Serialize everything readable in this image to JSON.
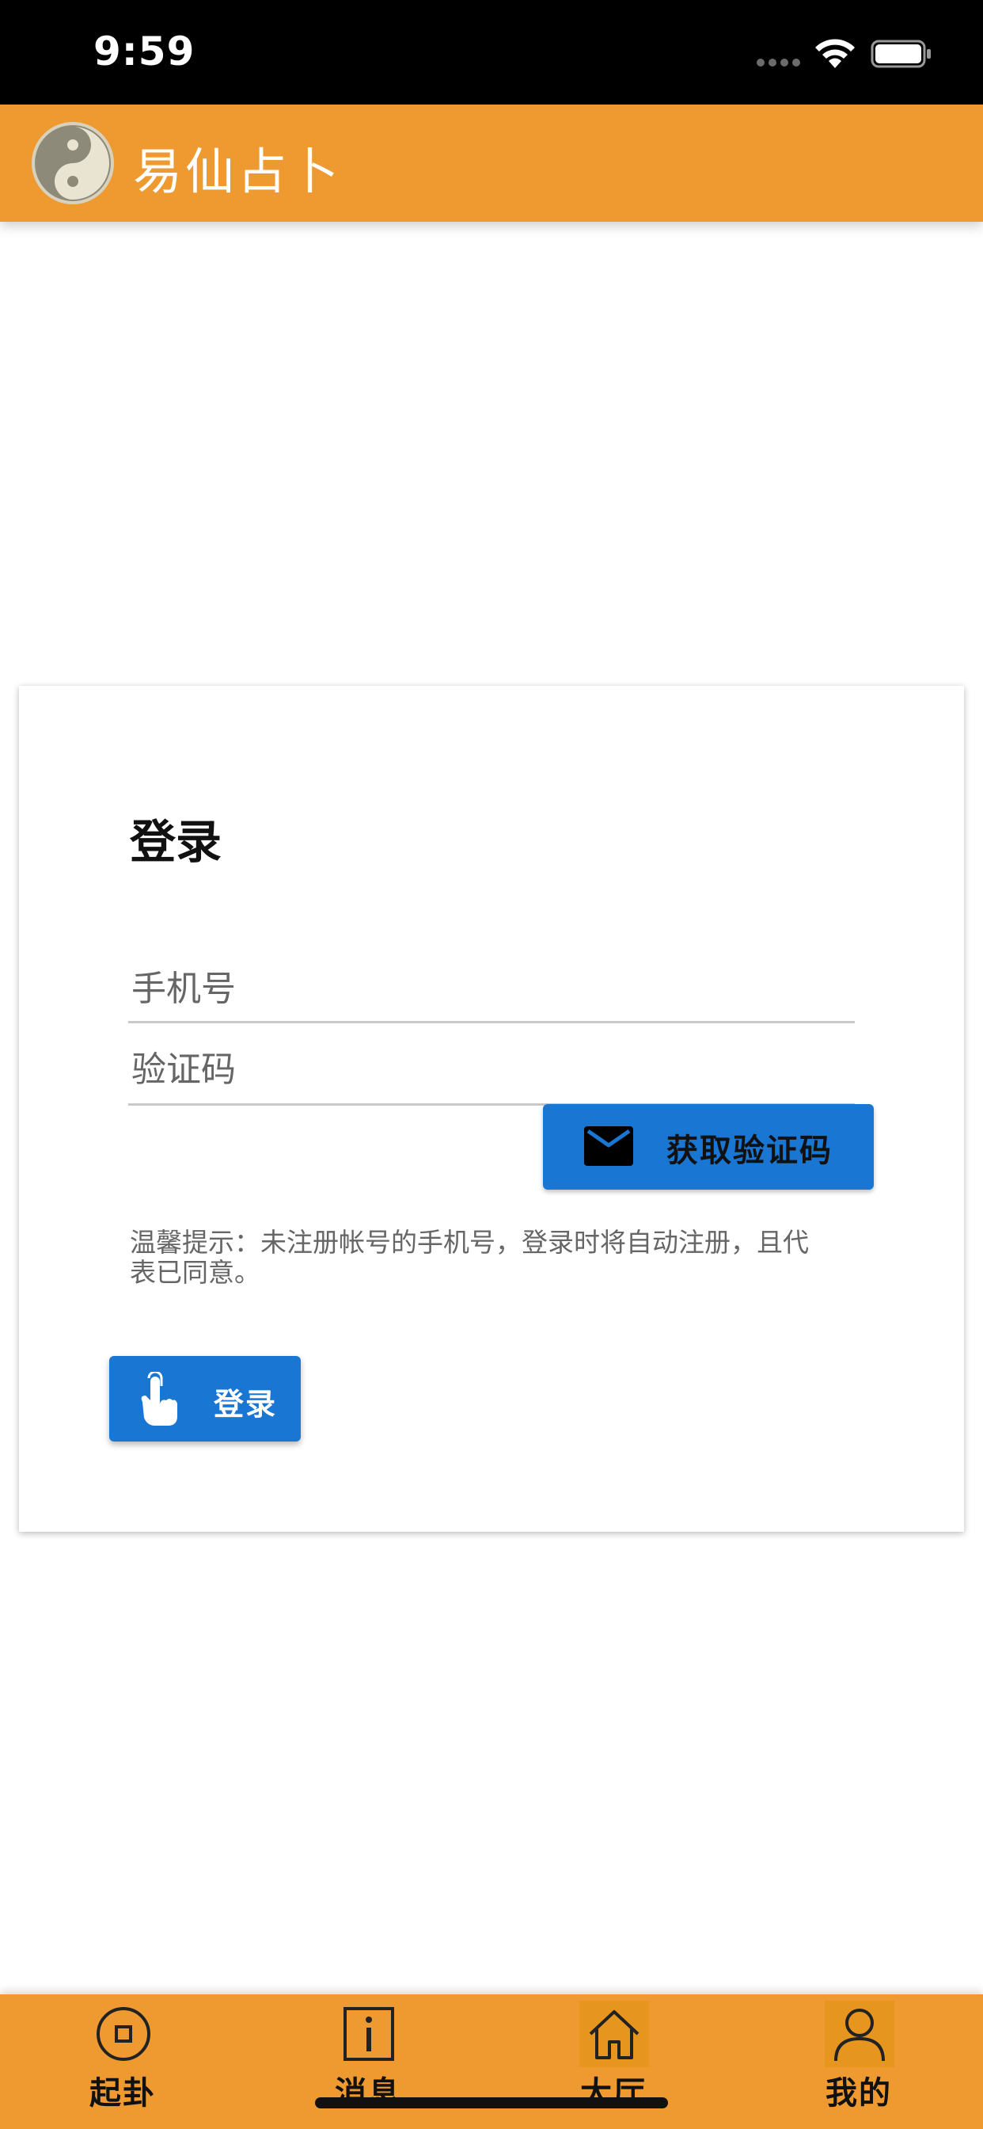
{
  "status_bar": {
    "time": "9:59"
  },
  "header": {
    "title": "易仙占卜"
  },
  "login": {
    "title": "登录",
    "phone_placeholder": "手机号",
    "code_placeholder": "验证码",
    "get_code_label": "获取验证码",
    "hint": "温馨提示：未注册帐号的手机号，登录时将自动注册，且代表已同意。",
    "login_label": "登录"
  },
  "bottom_nav": {
    "items": [
      {
        "label": "起卦",
        "icon": "coin-icon"
      },
      {
        "label": "消息",
        "icon": "info-icon"
      },
      {
        "label": "大厅",
        "icon": "home-icon"
      },
      {
        "label": "我的",
        "icon": "user-icon"
      }
    ]
  },
  "colors": {
    "brand_orange": "#ee9a30",
    "primary_blue": "#1976d2",
    "status_bar": "#000000"
  }
}
